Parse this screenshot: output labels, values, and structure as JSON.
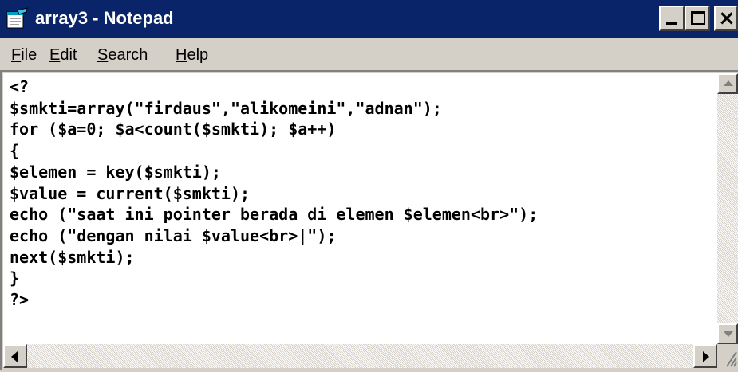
{
  "window": {
    "title": "array3 - Notepad",
    "icon": "notepad-icon",
    "controls": {
      "minimize": "minimize-icon",
      "maximize": "maximize-icon",
      "close": "close-icon",
      "close_glyph": "×"
    }
  },
  "menu": {
    "file": "File",
    "edit": "Edit",
    "search": "Search",
    "help": "Help"
  },
  "editor": {
    "code": "<?\n$smkti=array(\"firdaus\",\"alikomeini\",\"adnan\");\nfor ($a=0; $a<count($smkti); $a++)\n{\n$elemen = key($smkti);\n$value = current($smkti);\necho (\"saat ini pointer berada di elemen $elemen<br>\");\necho (\"dengan nilai $value<br>|\");\nnext($smkti);\n}\n?>"
  },
  "colors": {
    "titlebar": "#0a246a",
    "chrome": "#d4d0c8",
    "editor_bg": "#ffffff",
    "text": "#000000"
  }
}
